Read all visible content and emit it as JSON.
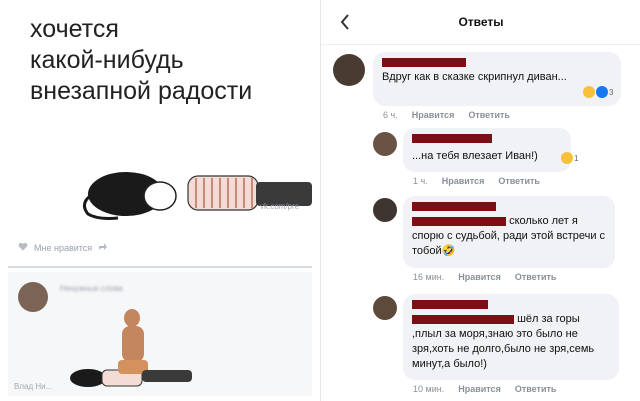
{
  "left": {
    "meme_text": "хочется\nкакой-нибудь\nвнезапной радости",
    "watermark": "vk.com/pre",
    "like_label": "Мне нравится",
    "bottom_name": "Ненужные слова",
    "bottom_watermark": "Влад Ни..."
  },
  "right": {
    "header": {
      "title": "Ответы"
    },
    "comments": [
      {
        "text": "Вдруг как в сказке скрипнул диван...",
        "time": "6 ч.",
        "like": "Нравится",
        "reply": "Ответить",
        "reaction_count": "3"
      },
      {
        "text": "...на тебя влезает Иван!)",
        "time": "1 ч.",
        "like": "Нравится",
        "reply": "Ответить",
        "reaction_count": "1"
      },
      {
        "text_tail": "сколько лет я",
        "text_rest": "спорю с судьбой, ради этой встречи с тобой🤣",
        "time": "16 мин.",
        "like": "Нравится",
        "reply": "Ответить"
      },
      {
        "text_tail": "шёл за",
        "text_rest": "горы ,плыл за моря,знаю это было не зря,хоть не долго,было не зря,семь минут,а было!)",
        "time": "10 мин.",
        "like": "Нравится",
        "reply": "Ответить"
      }
    ]
  }
}
